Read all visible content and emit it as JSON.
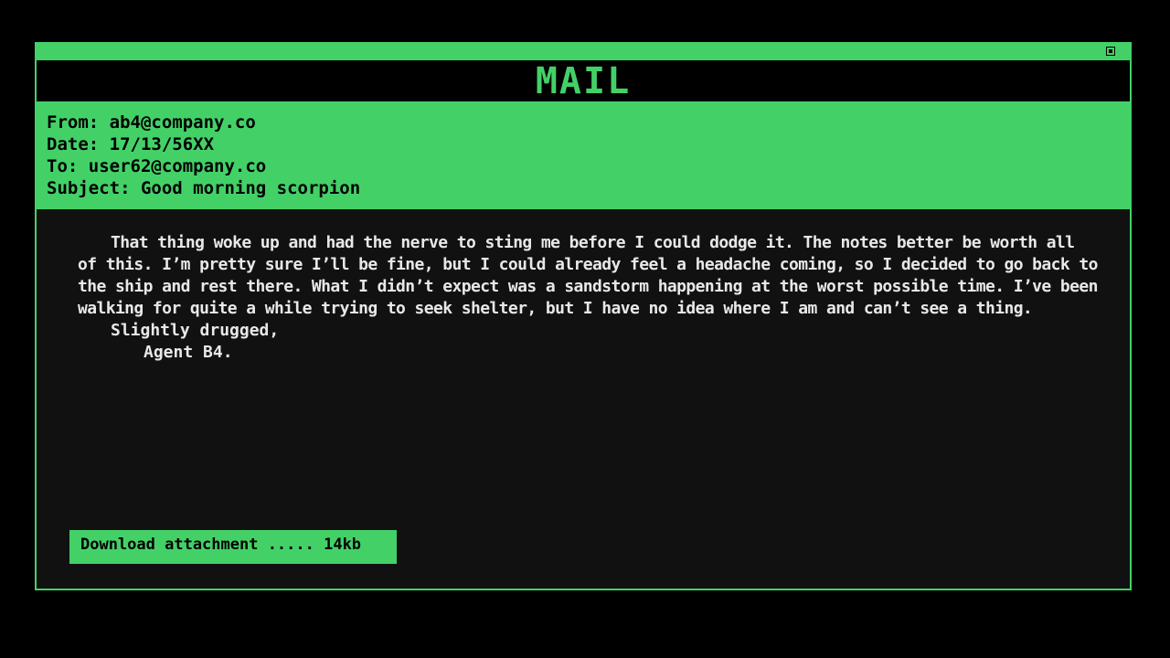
{
  "window": {
    "title": "MAIL"
  },
  "header": {
    "from_label": "From:",
    "from_value": "ab4@company.co",
    "date_label": "Date:",
    "date_value": "17/13/56XX",
    "to_label": "To:",
    "to_value": "user62@company.co",
    "subject_label": "Subject:",
    "subject_value": "Good morning scorpion"
  },
  "message": {
    "body": "That thing woke up and had the nerve to sting me before I could dodge it. The notes better be worth all of this. I’m pretty sure I’ll be fine, but I could already feel a headache coming, so I decided to go back to the ship and rest there. What I didn’t expect was a sandstorm happening at the worst possible time. I’ve been walking for quite a while trying to seek shelter, but I have no idea where I am and can’t see a thing.",
    "signoff": "Slightly drugged,",
    "signature": "Agent B4."
  },
  "attachment": {
    "label": "Download attachment ..... 14kb"
  },
  "colors": {
    "accent": "#43d167",
    "background": "#000000",
    "panel": "#111111",
    "text": "#e8e8e8"
  }
}
